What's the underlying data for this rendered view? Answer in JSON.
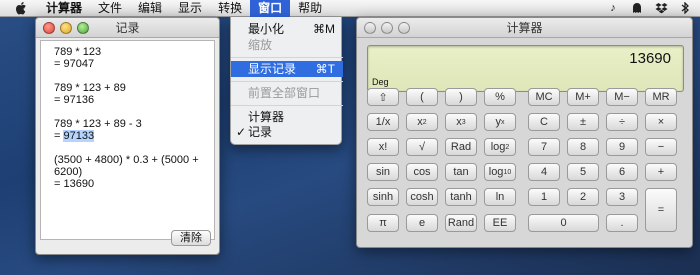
{
  "menubar": {
    "app_name": "计算器",
    "items": [
      "文件",
      "编辑",
      "显示",
      "转换",
      "窗口",
      "帮助"
    ]
  },
  "window_menu": {
    "items": [
      {
        "label": "最小化",
        "shortcut": "⌘M",
        "state": "normal"
      },
      {
        "label": "缩放",
        "shortcut": "",
        "state": "disabled"
      },
      {
        "label": "显示记录",
        "shortcut": "⌘T",
        "state": "highlighted"
      },
      {
        "label": "前置全部窗口",
        "shortcut": "",
        "state": "disabled"
      },
      {
        "label": "计算器",
        "shortcut": "",
        "state": "normal"
      },
      {
        "label": "记录",
        "shortcut": "",
        "state": "checked"
      }
    ]
  },
  "history": {
    "title": "记录",
    "entries": [
      {
        "expr": "789 * 123",
        "result": "= 97047"
      },
      {
        "expr": "789 * 123 + 89",
        "result": "= 97136"
      },
      {
        "expr": "789 * 123 + 89 - 3",
        "result_prefix": "= ",
        "result_selected": "97133"
      },
      {
        "expr": "(3500 + 4800) * 0.3 + (5000 + 6200)",
        "result": "= 13690"
      }
    ],
    "clear_label": "清除"
  },
  "calculator": {
    "title": "计算器",
    "display_value": "13690",
    "mode": "Deg",
    "keys": {
      "shift": "⇧",
      "lparen": "(",
      "rparen": ")",
      "percent": "%",
      "mc": "MC",
      "mplus": "M+",
      "mminus": "M−",
      "mr": "MR",
      "inv": "1/x",
      "x2": "x",
      "x3": "x",
      "yx": "y",
      "c": "C",
      "plusminus": "±",
      "divide": "÷",
      "multiply": "×",
      "fact": "x!",
      "sqrt": "√",
      "rad": "Rad",
      "log2": "log",
      "k7": "7",
      "k8": "8",
      "k9": "9",
      "minus": "−",
      "sin": "sin",
      "cos": "cos",
      "tan": "tan",
      "log10": "log",
      "k4": "4",
      "k5": "5",
      "k6": "6",
      "plus": "+",
      "sinh": "sinh",
      "cosh": "cosh",
      "tanh": "tanh",
      "ln": "ln",
      "k1": "1",
      "k2": "2",
      "k3": "3",
      "equals": "=",
      "pi": "π",
      "e": "e",
      "rand": "Rand",
      "ee": "EE",
      "k0": "0",
      "dot": "."
    },
    "superscripts": {
      "x2": "2",
      "x3": "3",
      "yx": "x"
    },
    "subscripts": {
      "log2": "2",
      "log10": "10"
    }
  },
  "colors": {
    "menu_highlight": "#2f6de0",
    "display_bg": "#e4eabd",
    "selection": "#b5d5ff"
  }
}
